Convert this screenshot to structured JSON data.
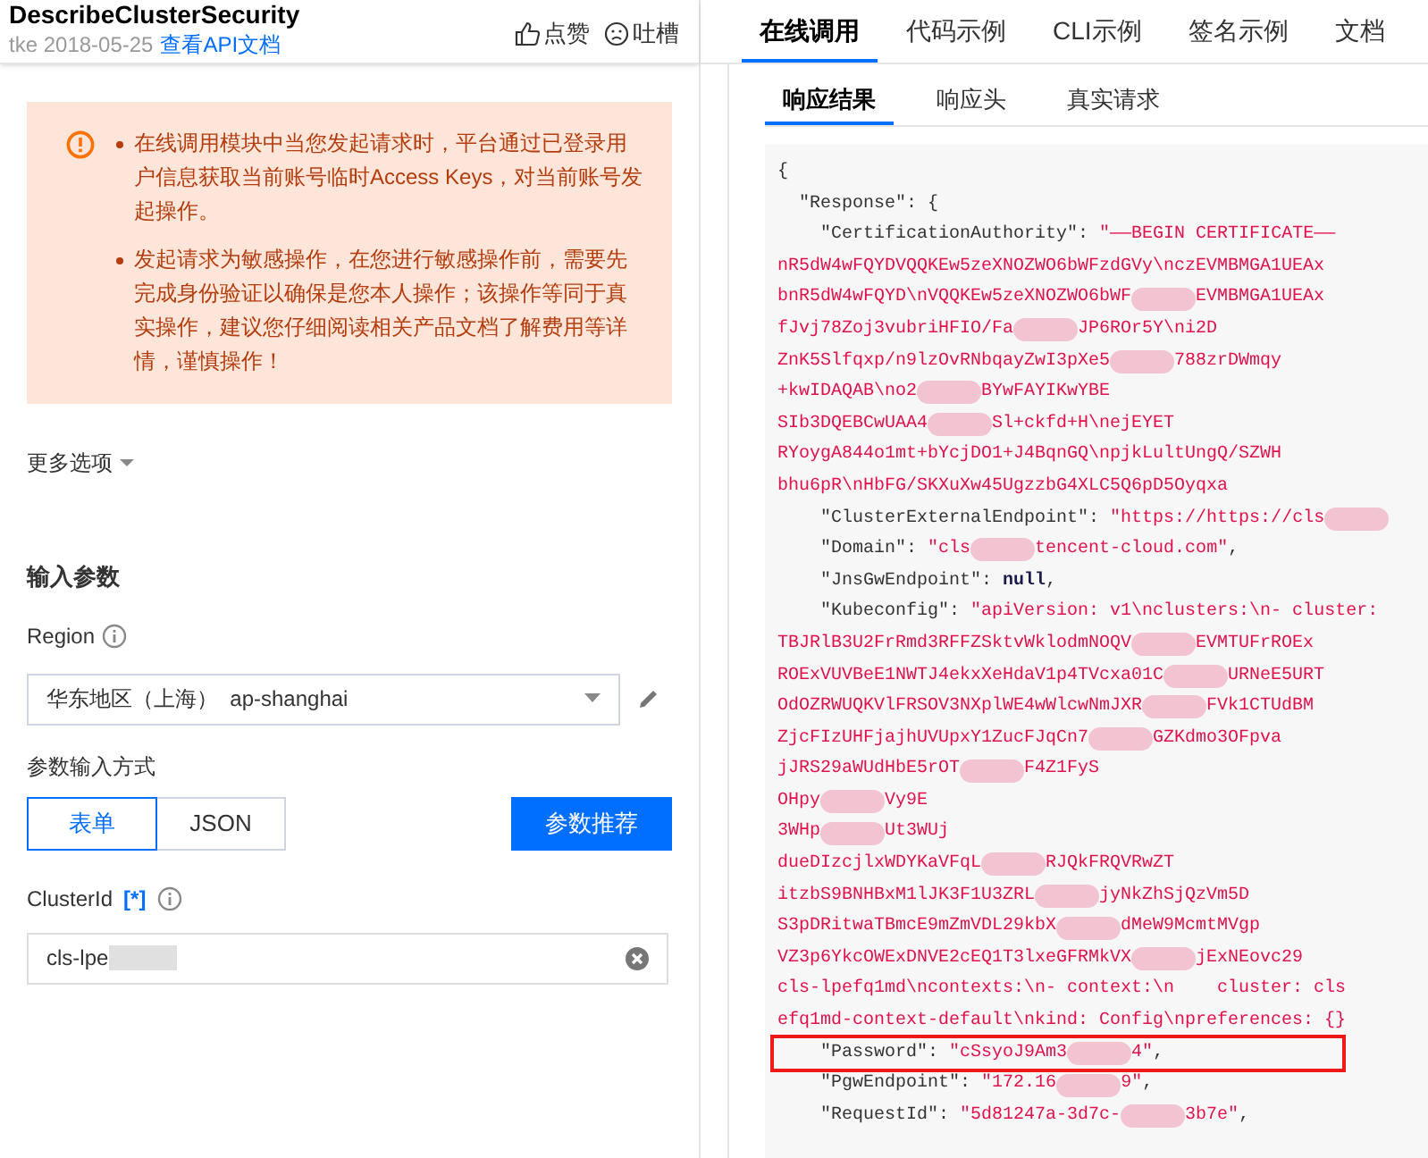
{
  "header": {
    "title": "DescribeClusterSecurity",
    "meta": "tke 2018-05-25",
    "doc_link": "查看API文档",
    "like": "点赞",
    "complain": "吐槽"
  },
  "notice": {
    "items": [
      "在线调用模块中当您发起请求时，平台通过已登录用户信息获取当前账号临时Access Keys，对当前账号发起操作。",
      "发起请求为敏感操作，在您进行敏感操作前，需要先完成身份验证以确保是您本人操作；该操作等同于真实操作，建议您仔细阅读相关产品文档了解费用等详情，谨慎操作！"
    ]
  },
  "more_options": {
    "label": "更多选项",
    "expanded": false
  },
  "params": {
    "heading": "输入参数",
    "region": {
      "label": "Region",
      "value": "华东地区（上海）  ap-shanghai"
    },
    "input_mode": {
      "label": "参数输入方式",
      "options": [
        {
          "label": "表单",
          "selected": true
        },
        {
          "label": "JSON",
          "selected": false
        }
      ],
      "recommend_button": "参数推荐"
    },
    "cluster_id": {
      "label": "ClusterId",
      "required_mark": "[*]",
      "value": "cls-lpe",
      "redacted": true
    }
  },
  "tabs": [
    {
      "label": "在线调用",
      "selected": true
    },
    {
      "label": "代码示例",
      "selected": false
    },
    {
      "label": "CLI示例",
      "selected": false
    },
    {
      "label": "签名示例",
      "selected": false
    },
    {
      "label": "文档",
      "selected": false
    }
  ],
  "sub_tabs": [
    {
      "label": "响应结果",
      "selected": true
    },
    {
      "label": "响应头",
      "selected": false
    },
    {
      "label": "真实请求",
      "selected": false
    }
  ],
  "code_lines": [
    {
      "highlighted": false,
      "segments": [
        {
          "kind": "plain",
          "text": "{"
        }
      ]
    },
    {
      "highlighted": false,
      "segments": [
        {
          "kind": "key",
          "text": "  \"Response\""
        },
        {
          "kind": "plain",
          "text": ": {"
        }
      ]
    },
    {
      "highlighted": false,
      "segments": [
        {
          "kind": "key",
          "text": "    \"CertificationAuthority\""
        },
        {
          "kind": "plain",
          "text": ": "
        },
        {
          "kind": "string",
          "text": "\"——BEGIN CERTIFICATE——"
        }
      ]
    },
    {
      "highlighted": false,
      "segments": [
        {
          "kind": "string",
          "text": "nR5dW4wFQYDVQQKEw5zeXNOZWO6bWFzdGVy\\nczEVMBMGA1UEAx"
        }
      ]
    },
    {
      "highlighted": false,
      "segments": [
        {
          "kind": "string",
          "text": "bnR5dW4wFQYD\\nVQQKEw5zeXNOZWO6bWF"
        },
        {
          "kind": "redacted"
        },
        {
          "kind": "string",
          "text": "EVMBMGA1UEAx"
        }
      ]
    },
    {
      "highlighted": false,
      "segments": [
        {
          "kind": "string",
          "text": "fJvj78Zoj3vubriHFIO/Fa"
        },
        {
          "kind": "redacted"
        },
        {
          "kind": "string",
          "text": "JP6ROr5Y\\ni2D"
        }
      ]
    },
    {
      "highlighted": false,
      "segments": [
        {
          "kind": "string",
          "text": "ZnK5Slfqxp/n9lzOvRNbqayZwI3pXe5"
        },
        {
          "kind": "redacted"
        },
        {
          "kind": "string",
          "text": "788zrDWmqy"
        }
      ]
    },
    {
      "highlighted": false,
      "segments": [
        {
          "kind": "string",
          "text": "+kwIDAQAB\\no2"
        },
        {
          "kind": "redacted"
        },
        {
          "kind": "string",
          "text": "BYwFAYIKwYBE"
        }
      ]
    },
    {
      "highlighted": false,
      "segments": [
        {
          "kind": "string",
          "text": "SIb3DQEBCwUAA4"
        },
        {
          "kind": "redacted"
        },
        {
          "kind": "string",
          "text": "Sl+ckfd+H\\nejEYET"
        }
      ]
    },
    {
      "highlighted": false,
      "segments": [
        {
          "kind": "string",
          "text": "RYoygA844o1mt+bYcjDO1+J4BqnGQ\\npjkLultUngQ/SZWH"
        }
      ]
    },
    {
      "highlighted": false,
      "segments": [
        {
          "kind": "string",
          "text": "bhu6pR\\nHbFG/SKXuXw45UgzzbG4XLC5Q6pD5Oyqxa"
        }
      ]
    },
    {
      "highlighted": false,
      "segments": [
        {
          "kind": "key",
          "text": "    \"ClusterExternalEndpoint\""
        },
        {
          "kind": "plain",
          "text": ": "
        },
        {
          "kind": "string",
          "text": "\"https://https://cls"
        },
        {
          "kind": "redacted"
        }
      ]
    },
    {
      "highlighted": false,
      "segments": [
        {
          "kind": "key",
          "text": "    \"Domain\""
        },
        {
          "kind": "plain",
          "text": ": "
        },
        {
          "kind": "string",
          "text": "\"cls"
        },
        {
          "kind": "redacted"
        },
        {
          "kind": "string",
          "text": "tencent-cloud.com\""
        },
        {
          "kind": "plain",
          "text": ","
        }
      ]
    },
    {
      "highlighted": false,
      "segments": [
        {
          "kind": "key",
          "text": "    \"JnsGwEndpoint\""
        },
        {
          "kind": "plain",
          "text": ": "
        },
        {
          "kind": "null",
          "text": "null"
        },
        {
          "kind": "plain",
          "text": ","
        }
      ]
    },
    {
      "highlighted": false,
      "segments": [
        {
          "kind": "key",
          "text": "    \"Kubeconfig\""
        },
        {
          "kind": "plain",
          "text": ": "
        },
        {
          "kind": "string",
          "text": "\"apiVersion: v1\\nclusters:\\n- cluster:"
        }
      ]
    },
    {
      "highlighted": false,
      "segments": [
        {
          "kind": "string",
          "text": "TBJRlB3U2FrRmd3RFFZSktvWklodmNOQV"
        },
        {
          "kind": "redacted"
        },
        {
          "kind": "string",
          "text": "EVMTUFrROEx"
        }
      ]
    },
    {
      "highlighted": false,
      "segments": [
        {
          "kind": "string",
          "text": "ROExVUVBeE1NWTJ4ekxXeHdaV1p4TVcxa01C"
        },
        {
          "kind": "redacted"
        },
        {
          "kind": "string",
          "text": "URNeE5URT"
        }
      ]
    },
    {
      "highlighted": false,
      "segments": [
        {
          "kind": "string",
          "text": "OdOZRWUQKVlFRSOV3NXplWE4wWlcwNmJXR"
        },
        {
          "kind": "redacted"
        },
        {
          "kind": "string",
          "text": "FVk1CTUdBM"
        }
      ]
    },
    {
      "highlighted": false,
      "segments": [
        {
          "kind": "string",
          "text": "ZjcFIzUHFjajhUVUpxY1ZucFJqCn7"
        },
        {
          "kind": "redacted"
        },
        {
          "kind": "string",
          "text": "GZKdmo3OFpva"
        }
      ]
    },
    {
      "highlighted": false,
      "segments": [
        {
          "kind": "string",
          "text": "jJRS29aWUdHbE5rOT"
        },
        {
          "kind": "redacted"
        },
        {
          "kind": "string",
          "text": "F4Z1FyS"
        }
      ]
    },
    {
      "highlighted": false,
      "segments": [
        {
          "kind": "string",
          "text": "OHpy"
        },
        {
          "kind": "redacted"
        },
        {
          "kind": "string",
          "text": "Vy9E"
        }
      ]
    },
    {
      "highlighted": false,
      "segments": [
        {
          "kind": "string",
          "text": "3WHp"
        },
        {
          "kind": "redacted"
        },
        {
          "kind": "string",
          "text": "Ut3WUj"
        }
      ]
    },
    {
      "highlighted": false,
      "segments": [
        {
          "kind": "string",
          "text": "dueDIzcjlxWDYKaVFqL"
        },
        {
          "kind": "redacted"
        },
        {
          "kind": "string",
          "text": "RJQkFRQVRwZT"
        }
      ]
    },
    {
      "highlighted": false,
      "segments": [
        {
          "kind": "string",
          "text": "itzbS9BNHBxM1lJK3F1U3ZRL"
        },
        {
          "kind": "redacted"
        },
        {
          "kind": "string",
          "text": "jyNkZhSjQzVm5D"
        }
      ]
    },
    {
      "highlighted": false,
      "segments": [
        {
          "kind": "string",
          "text": "S3pDRitwaTBmcE9mZmVDL29kbX"
        },
        {
          "kind": "redacted"
        },
        {
          "kind": "string",
          "text": "dMeW9McmtMVgp"
        }
      ]
    },
    {
      "highlighted": false,
      "segments": [
        {
          "kind": "string",
          "text": "VZ3p6YkcOWExDNVE2cEQ1T3lxeGFRMkVX"
        },
        {
          "kind": "redacted"
        },
        {
          "kind": "string",
          "text": "jExNEovc29"
        }
      ]
    },
    {
      "highlighted": false,
      "segments": [
        {
          "kind": "string",
          "text": "cls-lpefq1md\\ncontexts:\\n- context:\\n    cluster: cls"
        }
      ]
    },
    {
      "highlighted": false,
      "segments": [
        {
          "kind": "string",
          "text": "efq1md-context-default\\nkind: Config\\npreferences: {}"
        }
      ]
    },
    {
      "highlighted": true,
      "segments": [
        {
          "kind": "key",
          "text": "    \"Password\""
        },
        {
          "kind": "plain",
          "text": ": "
        },
        {
          "kind": "string",
          "text": "\"cSsyoJ9Am3"
        },
        {
          "kind": "redacted"
        },
        {
          "kind": "string",
          "text": "4\""
        },
        {
          "kind": "plain",
          "text": ","
        }
      ]
    },
    {
      "highlighted": false,
      "segments": [
        {
          "kind": "key",
          "text": "    \"PgwEndpoint\""
        },
        {
          "kind": "plain",
          "text": ": "
        },
        {
          "kind": "string",
          "text": "\"172.16"
        },
        {
          "kind": "redacted"
        },
        {
          "kind": "string",
          "text": "9\""
        },
        {
          "kind": "plain",
          "text": ","
        }
      ]
    },
    {
      "highlighted": false,
      "segments": [
        {
          "kind": "key",
          "text": "    \"RequestId\""
        },
        {
          "kind": "plain",
          "text": ": "
        },
        {
          "kind": "string",
          "text": "\"5d81247a-3d7c-"
        },
        {
          "kind": "redacted"
        },
        {
          "kind": "string",
          "text": "3b7e\""
        },
        {
          "kind": "plain",
          "text": ","
        }
      ]
    }
  ]
}
